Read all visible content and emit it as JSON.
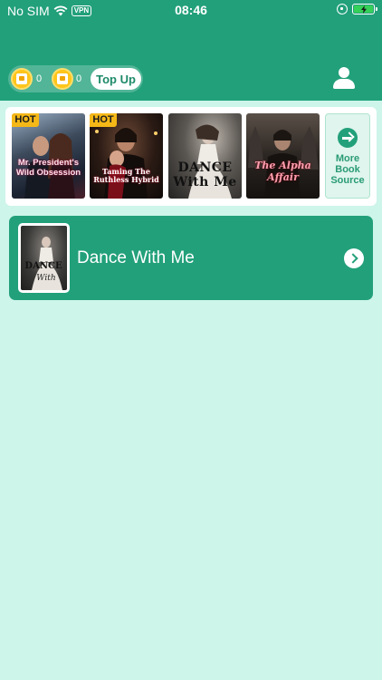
{
  "status_bar": {
    "carrier": "No SIM",
    "vpn": "VPN",
    "time": "08:46",
    "battery_color": "#34d058"
  },
  "wallet": {
    "coins_count": "0",
    "bonus_count": "0",
    "top_up_label": "Top Up"
  },
  "sources": {
    "items": [
      {
        "badge": "HOT",
        "title": "Mr. President's Wild Obsession"
      },
      {
        "badge": "HOT",
        "title": "Taming The Ruthless Hybrid"
      },
      {
        "badge": "",
        "title": "DANCE With Me"
      },
      {
        "badge": "",
        "title": "The Alpha Affair"
      }
    ],
    "more_label": "More Book Source"
  },
  "current_book": {
    "title": "Dance With Me"
  },
  "colors": {
    "brand": "#22a07a",
    "background": "#cdf5ea",
    "badge": "#f5b817",
    "coin": "#ffc51a"
  },
  "icons": [
    "wifi-icon",
    "rotation-lock-icon",
    "battery-icon",
    "coin-icon",
    "book-coin-icon",
    "profile-icon",
    "arrow-right-icon",
    "chevron-right-icon"
  ]
}
